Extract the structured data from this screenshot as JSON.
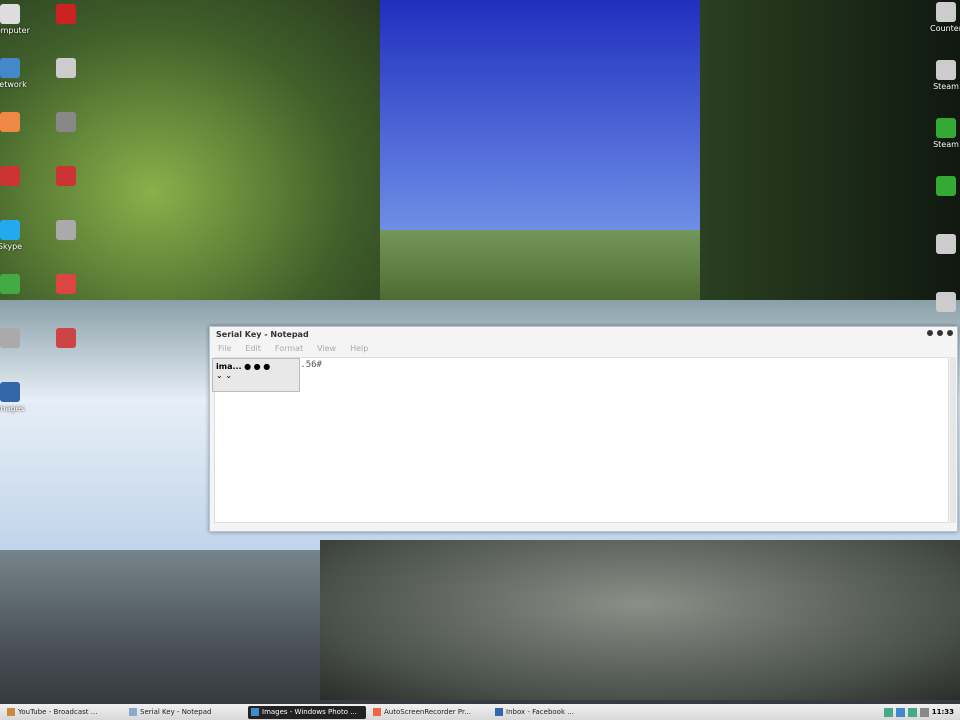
{
  "notepad": {
    "title": "Serial Key - Notepad",
    "menu": [
      "File",
      "Edit",
      "Format",
      "View",
      "Help"
    ],
    "content": "5...............56#"
  },
  "popup": {
    "label": "ima..."
  },
  "taskbar": {
    "items": [
      "YouTube - Broadcast ...",
      "Serial Key - Notepad",
      "Images - Windows Photo ...",
      "AutoScreenRecorder Pr...",
      "Inbox - Facebook ..."
    ],
    "active": 2,
    "clock": "11:33"
  },
  "desktop": {
    "left_icons": [
      "Computer",
      "Network",
      "",
      "",
      "Skype",
      "",
      "",
      "Images",
      "",
      "",
      "",
      "",
      "",
      "",
      ""
    ],
    "right_icons": [
      "Counter",
      "Steam",
      "Steam",
      "",
      "",
      "",
      "",
      ""
    ]
  }
}
